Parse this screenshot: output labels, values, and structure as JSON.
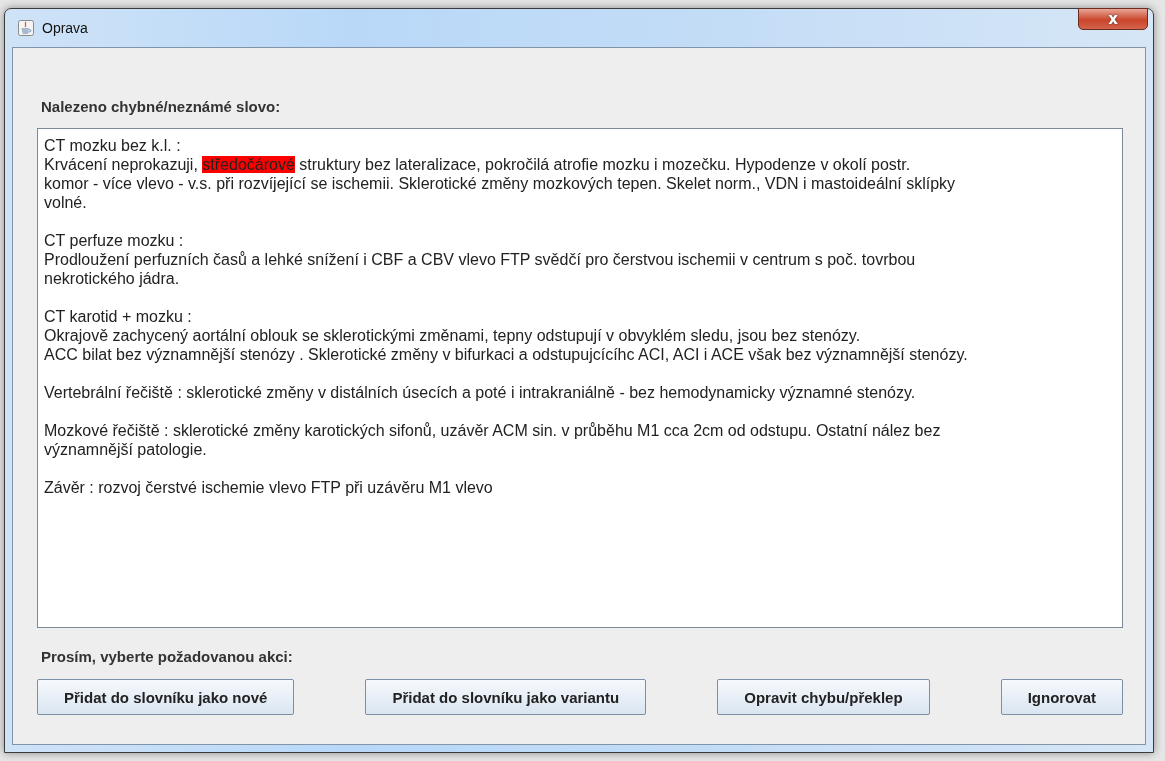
{
  "window": {
    "title": "Oprava",
    "close_label": "x"
  },
  "found_label": "Nalezeno chybné/neznámé slovo:",
  "document": {
    "blocks": [
      [
        [
          {
            "text": "CT mozku bez k.l. :",
            "highlighted": false
          }
        ],
        [
          {
            "text": "Krvácení neprokazuji,",
            "highlighted": false
          },
          {
            "text": "středočárové",
            "highlighted": true
          },
          {
            "text": "struktury bez lateralizace, pokročilá atrofie mozku i mozečku. Hypodenze v okolí postr.",
            "highlighted": false
          }
        ],
        [
          {
            "text": "komor - více vlevo - v.s. při rozvíjející se ischemii. Sklerotické změny mozkových tepen. Skelet norm., VDN i mastoideální sklípky",
            "highlighted": false
          }
        ],
        [
          {
            "text": "volné.",
            "highlighted": false
          }
        ]
      ],
      [
        [
          {
            "text": "CT perfuze mozku :",
            "highlighted": false
          }
        ],
        [
          {
            "text": "Prodloužení perfuzních časů a lehké snížení i CBF a CBV vlevo FTP svědčí pro čerstvou ischemii v centrum s poč. tovrbou",
            "highlighted": false
          }
        ],
        [
          {
            "text": "nekrotického jádra.",
            "highlighted": false
          }
        ]
      ],
      [
        [
          {
            "text": "CT karotid + mozku :",
            "highlighted": false
          }
        ],
        [
          {
            "text": "Okrajově zachycený aortální oblouk se sklerotickými změnami, tepny odstupují v obvyklém sledu, jsou bez stenózy.",
            "highlighted": false
          }
        ],
        [
          {
            "text": "ACC bilat bez významnější stenózy . Sklerotické změny v bifurkaci a odstupujcícíhc ACI, ACI i ACE však bez významnější stenózy.",
            "highlighted": false
          }
        ]
      ],
      [
        [
          {
            "text": "Vertebrální řečiště : sklerotické změny v distálních úsecích a poté i intrakraniálně - bez hemodynamicky významné stenózy.",
            "highlighted": false
          }
        ]
      ],
      [
        [
          {
            "text": "Mozkové řečiště : sklerotické změny karotických sifonů, uzávěr ACM sin. v průběhu M1 cca 2cm od odstupu. Ostatní nález bez",
            "highlighted": false
          }
        ],
        [
          {
            "text": "významnější patologie.",
            "highlighted": false
          }
        ]
      ],
      [
        [
          {
            "text": "Závěr : rozvoj čerstvé ischemie vlevo FTP při uzávěru M1 vlevo",
            "highlighted": false
          }
        ]
      ]
    ]
  },
  "action_label": "Prosím, vyberte požadovanou akci:",
  "buttons": [
    "Přidat do slovníku jako nové",
    "Přidat do slovníku jako variantu",
    "Opravit chybu/překlep",
    "Ignorovat"
  ]
}
